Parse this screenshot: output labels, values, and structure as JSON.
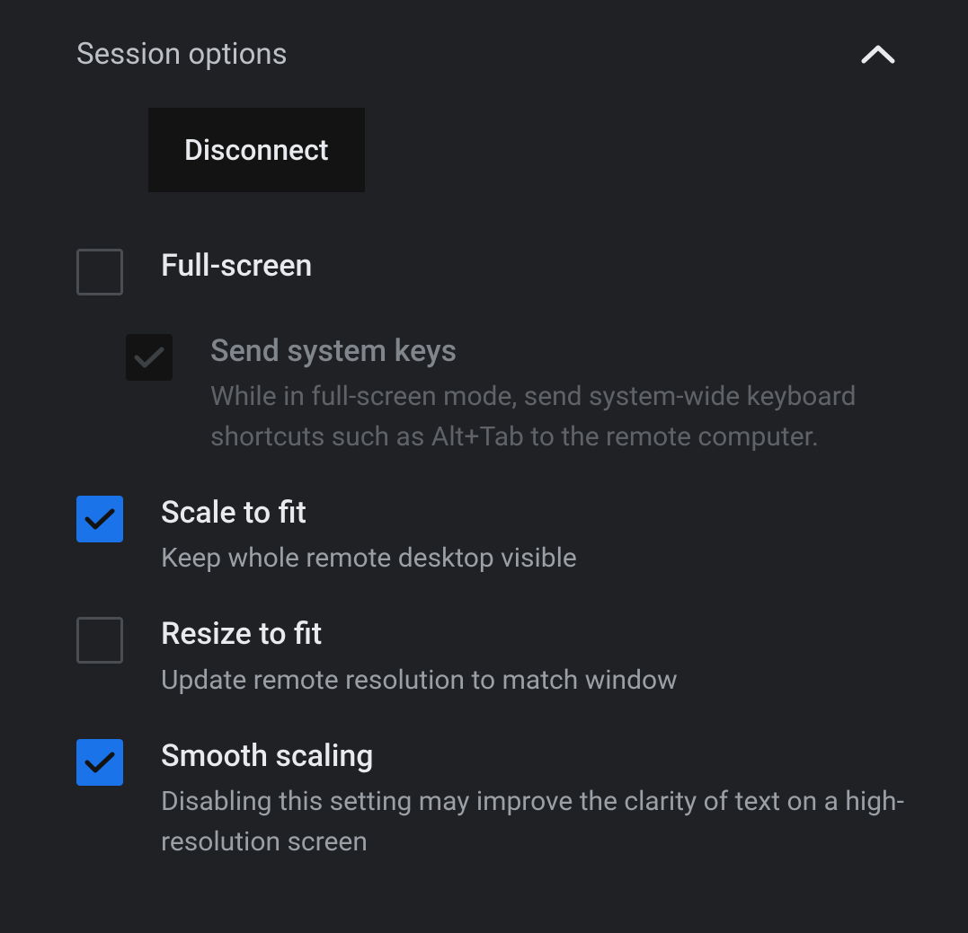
{
  "header": {
    "title": "Session options"
  },
  "disconnect_label": "Disconnect",
  "options": {
    "full_screen": {
      "label": "Full-screen",
      "checked": false
    },
    "send_system_keys": {
      "label": "Send system keys",
      "description": "While in full-screen mode, send system-wide keyboard shortcuts such as Alt+Tab to the remote computer.",
      "checked": true,
      "disabled": true
    },
    "scale_to_fit": {
      "label": "Scale to fit",
      "description": "Keep whole remote desktop visible",
      "checked": true
    },
    "resize_to_fit": {
      "label": "Resize to fit",
      "description": "Update remote resolution to match window",
      "checked": false
    },
    "smooth_scaling": {
      "label": "Smooth scaling",
      "description": "Disabling this setting may improve the clarity of text on a high-resolution screen",
      "checked": true
    }
  }
}
